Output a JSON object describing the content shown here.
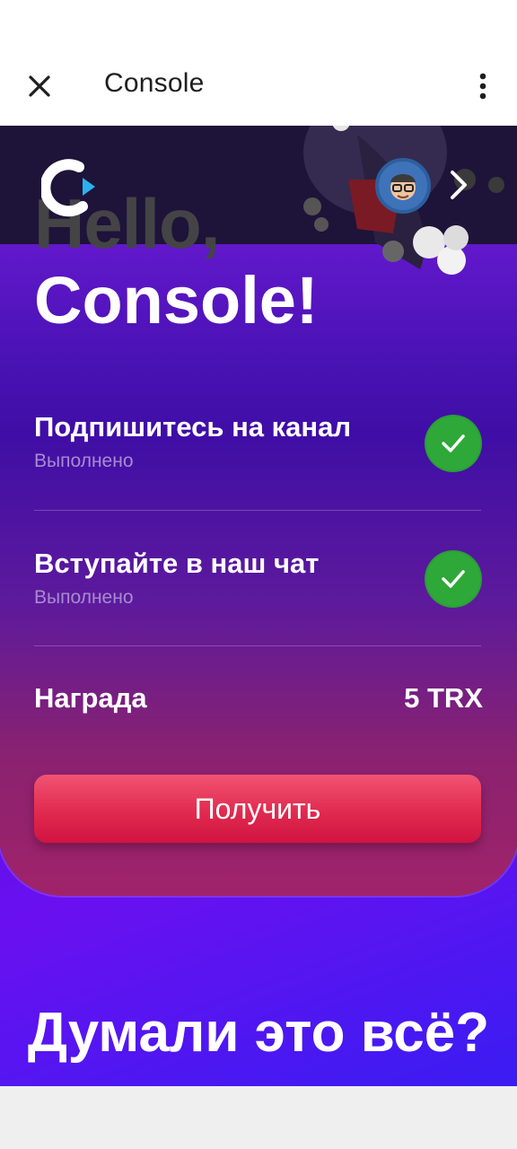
{
  "appbar": {
    "title": "Console"
  },
  "hero": {
    "greeting": "Hello,",
    "name": "Console!"
  },
  "tasks": [
    {
      "title": "Подпишитесь на канал",
      "status": "Выполнено"
    },
    {
      "title": "Вступайте в наш чат",
      "status": "Выполнено"
    }
  ],
  "reward": {
    "label": "Награда",
    "value": "5 TRX"
  },
  "button": {
    "label": "Получить"
  },
  "promo": {
    "heading": "Думали это всё?"
  },
  "colors": {
    "accent_button": "#e12a4f",
    "check_green": "#2ea838",
    "background_purple": "#5b0fe6"
  },
  "icons": {
    "close": "close-icon",
    "more": "more-vertical-icon",
    "logo": "console-logo",
    "check": "check-icon",
    "chevron": "chevron-right-icon"
  }
}
